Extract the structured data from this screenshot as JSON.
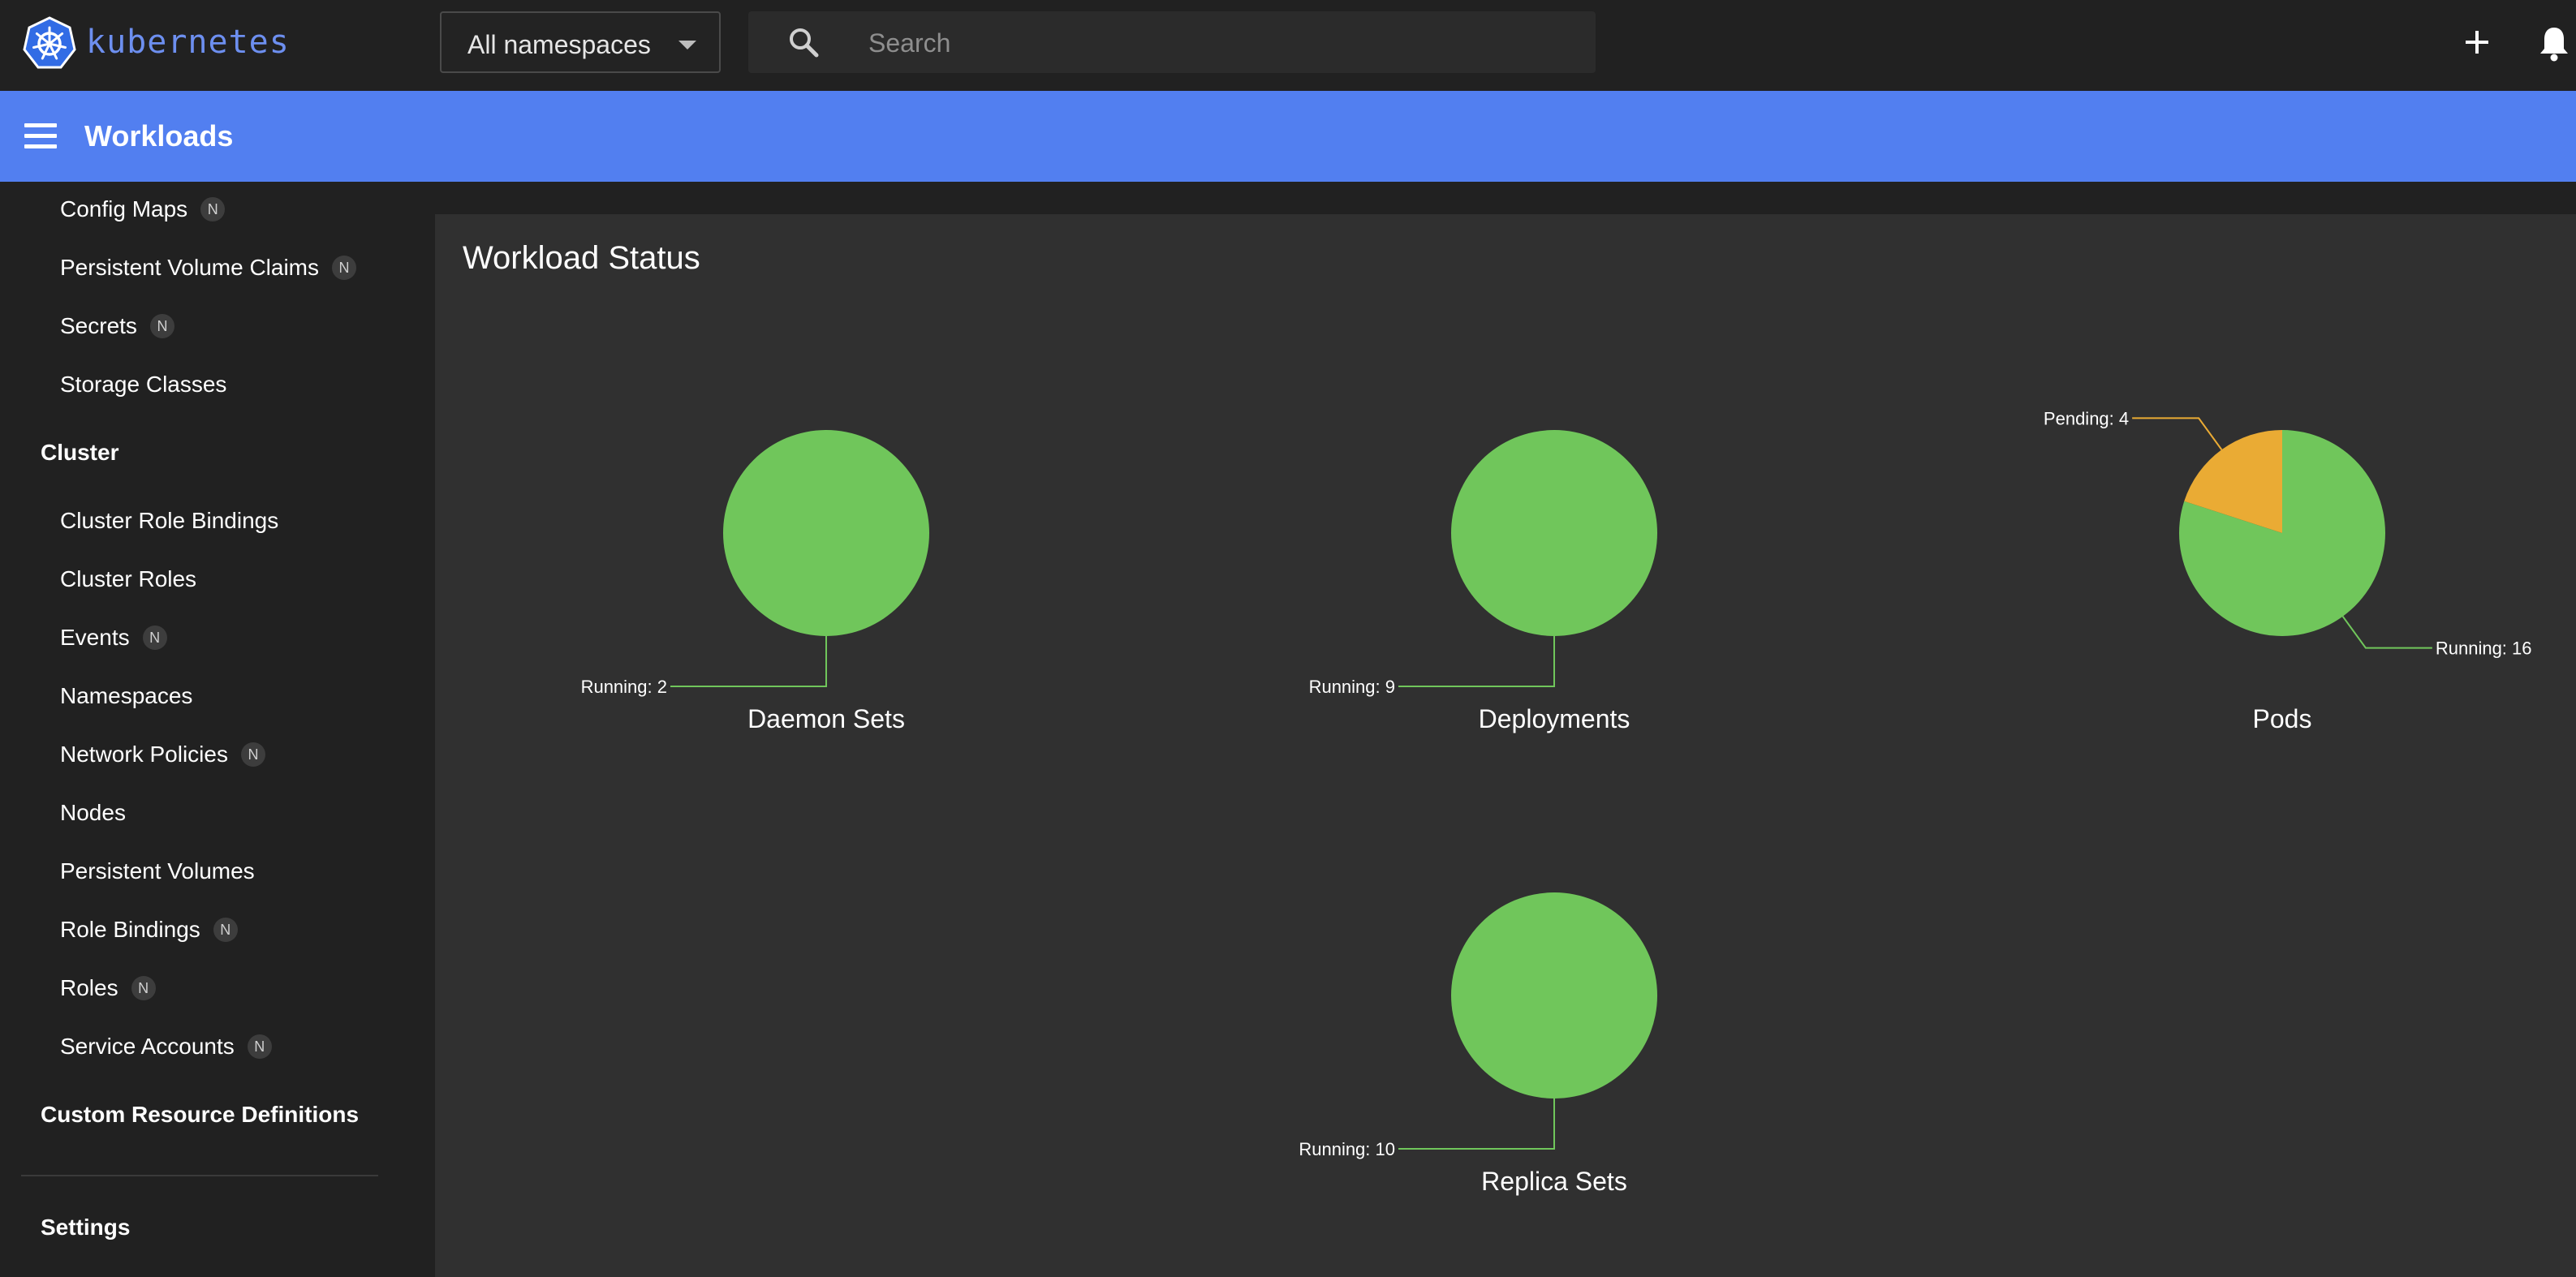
{
  "app": {
    "brand": "kubernetes",
    "logo_icon": "kubernetes-helm-icon"
  },
  "topbar": {
    "namespace_value": "All namespaces",
    "search_placeholder": "Search",
    "search_icon": "search-icon",
    "create_icon": "plus-icon",
    "notifications_icon": "bell-icon"
  },
  "header": {
    "title": "Workloads",
    "menu_icon": "hamburger-menu-icon"
  },
  "sidebar": {
    "clipped_item": {
      "label": "Config Maps",
      "badge": "N"
    },
    "items_top": [
      {
        "label": "Persistent Volume Claims",
        "badge": "N"
      },
      {
        "label": "Secrets",
        "badge": "N"
      },
      {
        "label": "Storage Classes",
        "badge": ""
      }
    ],
    "cluster": {
      "label": "Cluster",
      "items": [
        {
          "label": "Cluster Role Bindings",
          "badge": ""
        },
        {
          "label": "Cluster Roles",
          "badge": ""
        },
        {
          "label": "Events",
          "badge": "N"
        },
        {
          "label": "Namespaces",
          "badge": ""
        },
        {
          "label": "Network Policies",
          "badge": "N"
        },
        {
          "label": "Nodes",
          "badge": ""
        },
        {
          "label": "Persistent Volumes",
          "badge": ""
        },
        {
          "label": "Role Bindings",
          "badge": "N"
        },
        {
          "label": "Roles",
          "badge": "N"
        },
        {
          "label": "Service Accounts",
          "badge": "N"
        }
      ]
    },
    "crd_label": "Custom Resource Definitions",
    "settings_label": "Settings"
  },
  "main": {
    "card_title": "Workload Status"
  },
  "colors": {
    "running": "#70c65b",
    "pending": "#eaab34"
  },
  "chart_data": [
    {
      "type": "pie",
      "title": "Daemon Sets",
      "slices": [
        {
          "label": "Running",
          "value": 2
        }
      ]
    },
    {
      "type": "pie",
      "title": "Deployments",
      "slices": [
        {
          "label": "Running",
          "value": 9
        }
      ]
    },
    {
      "type": "pie",
      "title": "Pods",
      "slices": [
        {
          "label": "Running",
          "value": 16
        },
        {
          "label": "Pending",
          "value": 4
        }
      ]
    },
    {
      "type": "pie",
      "title": "Replica Sets",
      "slices": [
        {
          "label": "Running",
          "value": 10
        }
      ]
    }
  ]
}
